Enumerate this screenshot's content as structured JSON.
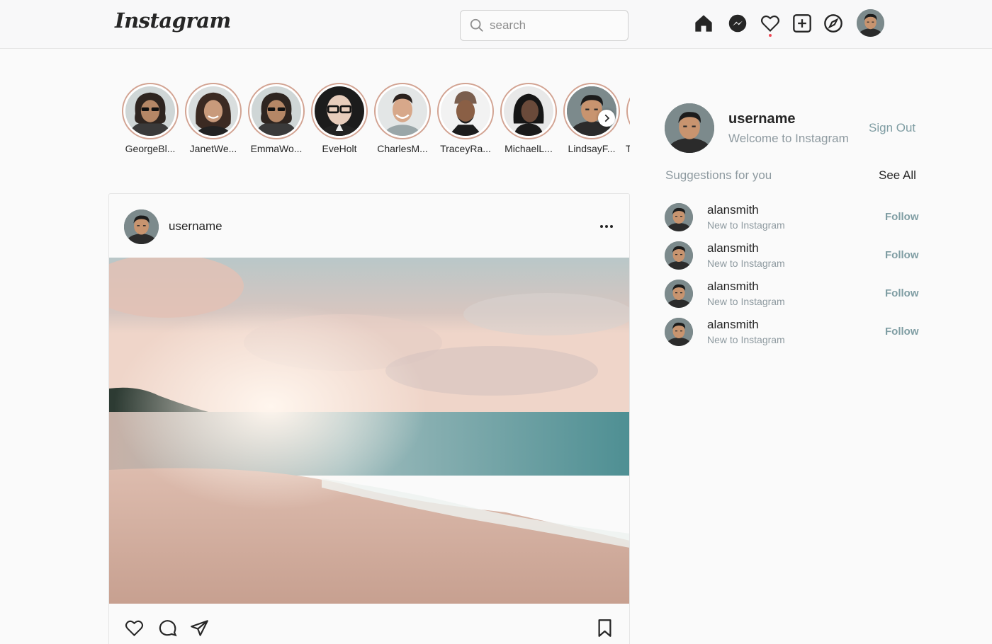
{
  "header": {
    "logo_text": "Instagram",
    "search_placeholder": "search",
    "icons": [
      "home-icon",
      "messenger-icon",
      "heart-icon",
      "new-post-icon",
      "explore-icon",
      "profile-avatar"
    ]
  },
  "stories": [
    {
      "name": "GeorgeBl..."
    },
    {
      "name": "JanetWe..."
    },
    {
      "name": "EmmaWo..."
    },
    {
      "name": "EveHolt"
    },
    {
      "name": "CharlesM..."
    },
    {
      "name": "TraceyRa..."
    },
    {
      "name": "MichaelL..."
    },
    {
      "name": "LindsayF..."
    },
    {
      "name": "T"
    }
  ],
  "post": {
    "username": "username",
    "image_alt": "beach-sunset"
  },
  "sidebar": {
    "username": "username",
    "welcome": "Welcome to Instagram",
    "sign_out": "Sign Out",
    "suggestions_title": "Suggestions for you",
    "see_all": "See All",
    "suggestions": [
      {
        "name": "alansmith",
        "sub": "New to Instagram",
        "action": "Follow"
      },
      {
        "name": "alansmith",
        "sub": "New to Instagram",
        "action": "Follow"
      },
      {
        "name": "alansmith",
        "sub": "New to Instagram",
        "action": "Follow"
      },
      {
        "name": "alansmith",
        "sub": "New to Instagram",
        "action": "Follow"
      }
    ]
  },
  "colors": {
    "story_ring": "#d2a392",
    "accent_link": "#7f9da3",
    "notification_dot": "#ed4956"
  }
}
